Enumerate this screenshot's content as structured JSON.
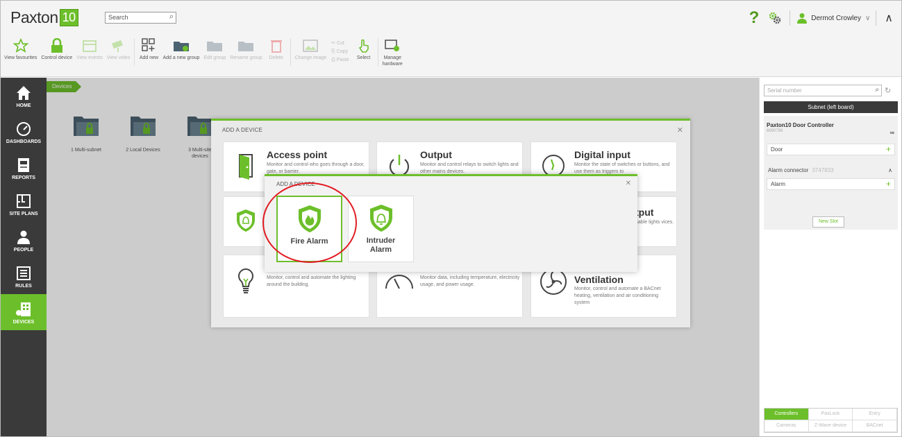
{
  "app": {
    "logo_text": "Paxton",
    "logo_badge": "10"
  },
  "header": {
    "search_placeholder": "Search",
    "user_name": "Dermot Crowley"
  },
  "toolbar": {
    "view_favourites": "View favourites",
    "control_device": "Control device",
    "view_events": "View events",
    "view_video": "View video",
    "add_new": "Add new",
    "add_new_group": "Add a new group",
    "edit_group": "Edit group",
    "rename_group": "Rename group",
    "delete": "Delete",
    "change_image": "Change image",
    "cut": "Cut",
    "copy": "Copy",
    "paste": "Paste",
    "select": "Select",
    "manage_hardware_1": "Manage",
    "manage_hardware_2": "hardware"
  },
  "nav": {
    "home": "HOME",
    "dashboards": "DASHBOARDS",
    "reports": "REPORTS",
    "site_plans": "SITE PLANS",
    "people": "PEOPLE",
    "rules": "RULES",
    "devices": "DEVICES"
  },
  "breadcrumb": "Devices",
  "folders": [
    {
      "label": "1 Multi-subnet"
    },
    {
      "label": "2 Local Devices"
    },
    {
      "label": "3 Multi-site devices"
    }
  ],
  "right_panel": {
    "search_placeholder": "Serial number",
    "subnet_title": "Subnet (left board)",
    "controller_name": "Paxton10 Door Controller",
    "controller_serial": "6690799",
    "door_slot": "Door",
    "alarm_connector": "Alarm connector",
    "alarm_connector_serial": "3747833",
    "alarm_slot": "Alarm",
    "new_slot": "New Slot",
    "tabs": [
      "Controllers",
      "PaxLock",
      "Entry",
      "Cameras",
      "Z-Wave device",
      "BACnet"
    ]
  },
  "dialog_add_device": {
    "title": "ADD A DEVICE",
    "cards": [
      {
        "title": "Access point",
        "desc": "Monitor and control who goes through a door, gate, or barrier."
      },
      {
        "title": "Output",
        "desc": "Monitor and control relays to switch lights and other mains devices."
      },
      {
        "title": "Digital input",
        "desc": "Monitor the state of switches or buttons, and use them as triggers to"
      },
      {
        "title": "",
        "desc": ""
      },
      {
        "title": "",
        "desc": ""
      },
      {
        "title": "tput",
        "desc": "nable lights vices."
      },
      {
        "title": "",
        "desc": "Monitor, control and automate the lighting around the building."
      },
      {
        "title": "",
        "desc": "Monitor data, including temperature, electricity usage, and power usage."
      },
      {
        "title": "Ventilation",
        "desc": "Monitor, control and automate a BACnet heating, ventilation and air conditioning system"
      }
    ]
  },
  "dialog_alarm": {
    "title": "ADD A DEVICE",
    "options": [
      {
        "label": "Fire Alarm"
      },
      {
        "label": "Intruder Alarm"
      }
    ]
  },
  "colors": {
    "accent": "#6cbf2a",
    "nav_bg": "#3a3a3a",
    "highlight": "#e21d23"
  }
}
